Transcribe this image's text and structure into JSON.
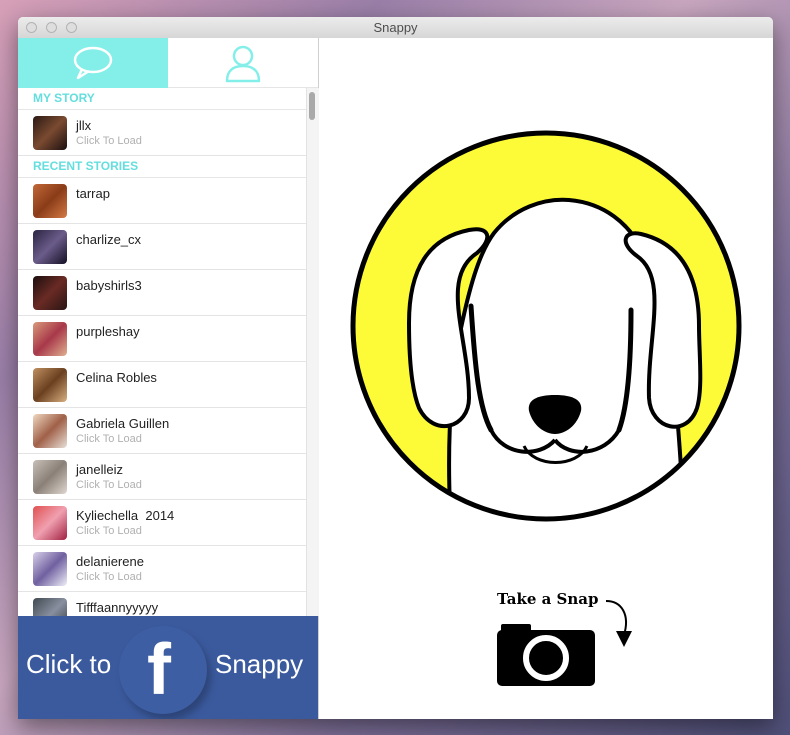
{
  "window": {
    "title": "Snappy"
  },
  "tabs": [
    {
      "name": "messages",
      "icon": "chat-bubble-icon",
      "active": true
    },
    {
      "name": "profile",
      "icon": "person-icon",
      "active": false
    }
  ],
  "my_story": {
    "header": "MY STORY",
    "items": [
      {
        "username": "jllx",
        "status": "Click To Load"
      }
    ]
  },
  "recent_stories": {
    "header": "RECENT STORIES",
    "items": [
      {
        "username": "tarrap",
        "status": ""
      },
      {
        "username": "charlize_cx",
        "status": ""
      },
      {
        "username": "babyshirls3",
        "status": ""
      },
      {
        "username": "purpleshay",
        "status": ""
      },
      {
        "username": "Celina Robles",
        "status": ""
      },
      {
        "username": "Gabriela Guillen",
        "status": "Click To Load"
      },
      {
        "username": "janelleiz",
        "status": "Click To Load"
      },
      {
        "username": "Kyliechella  2014",
        "status": "Click To Load"
      },
      {
        "username": "delanierene",
        "status": "Click To Load"
      },
      {
        "username": "Tifffaannyyyyy",
        "status": ""
      }
    ]
  },
  "facebook_bar": {
    "left_text": "Click to",
    "right_text": "Snappy",
    "logo_letter": "f"
  },
  "main": {
    "take_snap_label": "Take a Snap"
  },
  "colors": {
    "tab_active": "#84efe9",
    "section_header": "#65dede",
    "facebook_blue": "#3b5a9e",
    "logo_yellow": "#fdfb37"
  }
}
